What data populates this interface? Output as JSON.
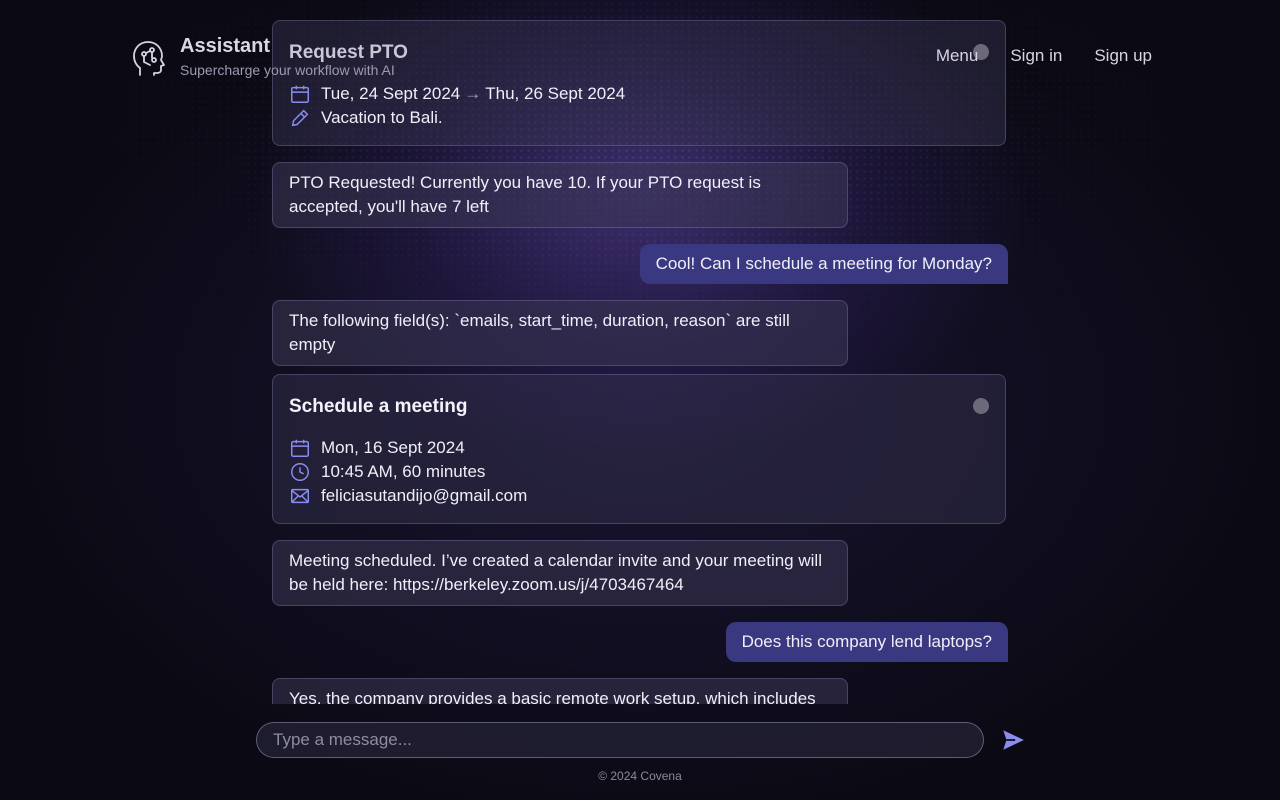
{
  "header": {
    "title": "Assistant",
    "subtitle": "Supercharge your workflow with AI",
    "logo_icon": "brain-head-icon",
    "nav": {
      "menu": "Menu",
      "sign_in": "Sign in",
      "sign_up": "Sign up"
    }
  },
  "chat": {
    "pto_card": {
      "title": "Request PTO",
      "date_start": "Tue, 24 Sept 2024",
      "date_arrow": "→",
      "date_end": "Thu, 26 Sept 2024",
      "reason": "Vacation to Bali.",
      "icons": [
        "calendar-icon",
        "pencil-icon"
      ]
    },
    "msg_pto_requested": "PTO Requested! Currently you have 10. If your PTO request is accepted, you'll have 7 left",
    "msg_user_meeting": "Cool! Can I schedule a meeting for Monday?",
    "msg_fields_empty": "The following field(s): `emails, start_time, duration, reason` are still empty",
    "meeting_card": {
      "title": "Schedule a meeting",
      "date": "Mon, 16 Sept 2024",
      "time": "10:45 AM, 60 minutes",
      "email": "feliciasutandijo@gmail.com",
      "icons": [
        "calendar-icon",
        "clock-icon",
        "mail-icon"
      ]
    },
    "msg_meeting_scheduled": "Meeting scheduled. I’ve created a calendar invite and your meeting will be held here: https://berkeley.zoom.us/j/4703467464",
    "msg_user_laptops": "Does this company lend laptops?",
    "msg_laptops_answer": "Yes, the company provides a basic remote work setup, which includes"
  },
  "composer": {
    "placeholder": "Type a message...",
    "send_icon": "send-icon"
  },
  "footer": {
    "copyright": "© 2024 Covena"
  },
  "colors": {
    "accent": "#8a8cf0",
    "user_bubble": "#3a3880",
    "background": "#0b0a14",
    "status_dot": "#6c6a78"
  }
}
